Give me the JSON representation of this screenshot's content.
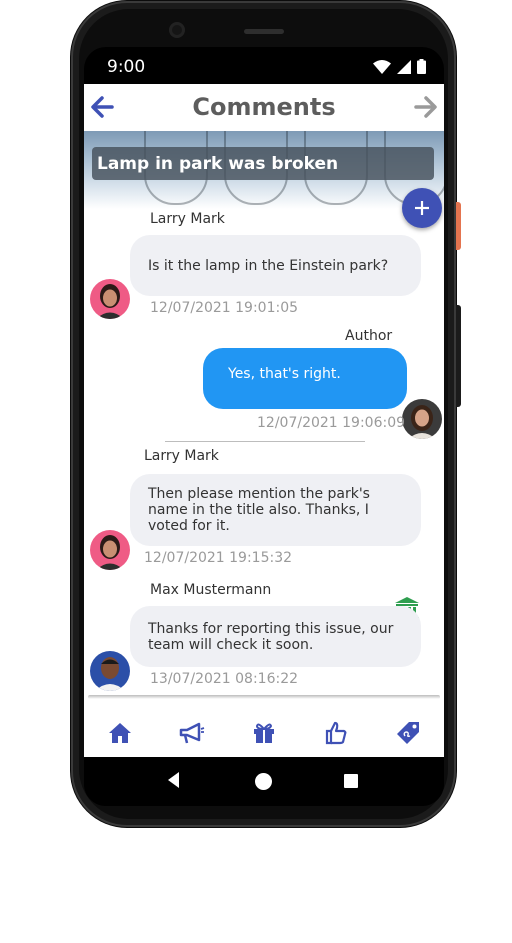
{
  "status_bar": {
    "time": "9:00"
  },
  "app_bar": {
    "title": "Comments"
  },
  "issue": {
    "title": "Lamp in park was broken"
  },
  "comments": [
    {
      "author": "Larry Mark",
      "text": "Is it the lamp in the Einstein park?",
      "timestamp": "12/07/2021 19:01:05",
      "mine": false
    },
    {
      "author": "Author",
      "text": "Yes, that's right.",
      "timestamp": "12/07/2021 19:06:09",
      "mine": true
    },
    {
      "author": "Larry Mark",
      "text": "Then please mention the park's name in the title also. Thanks, I voted for it.",
      "timestamp": "12/07/2021 19:15:32",
      "mine": false
    },
    {
      "author": "Max Mustermann",
      "text": "Thanks for reporting this issue, our team will check it soon.",
      "timestamp": "13/07/2021 08:16:22",
      "mine": false,
      "official": true
    }
  ],
  "tabs": [
    {
      "icon": "home-icon"
    },
    {
      "icon": "megaphone-icon"
    },
    {
      "icon": "gift-icon"
    },
    {
      "icon": "thumbs-up-icon"
    },
    {
      "icon": "tag-icon"
    }
  ],
  "colors": {
    "primary": "#3f51b5",
    "own_bubble": "#2196f3",
    "other_bubble": "#eff0f4",
    "official_icon": "#2e9e4f"
  }
}
